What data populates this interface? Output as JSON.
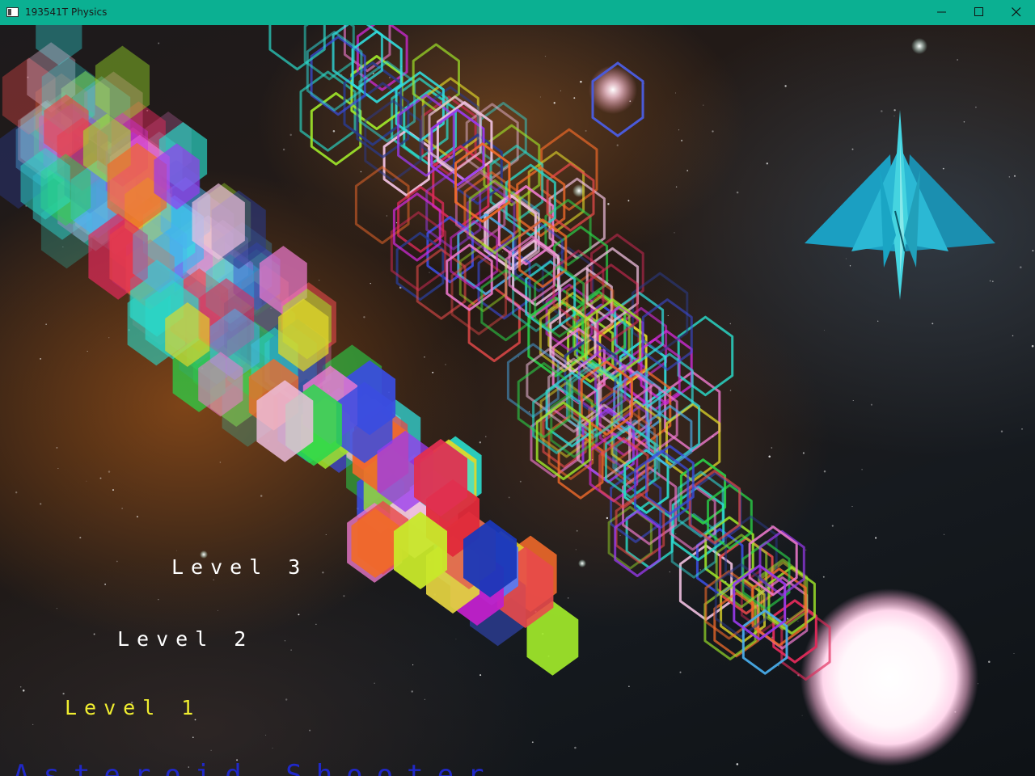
{
  "window": {
    "title": "193541T Physics",
    "controls": [
      "minimize-icon",
      "maximize-icon",
      "close-icon"
    ]
  },
  "menu": {
    "title": "Asteroid Shooter",
    "levels": [
      {
        "label": "Level 3",
        "color": "#ffffff",
        "selected": false
      },
      {
        "label": "Level 2",
        "color": "#ffffff",
        "selected": false
      },
      {
        "label": "Level 1",
        "color": "#f0ee30",
        "selected": true
      }
    ],
    "title_color": "#2028c8"
  },
  "scene": {
    "ship_color": "#1fb5cf",
    "player_ship_icon": "spaceship-icon"
  },
  "colors": {
    "titlebar": "#0bb092"
  }
}
